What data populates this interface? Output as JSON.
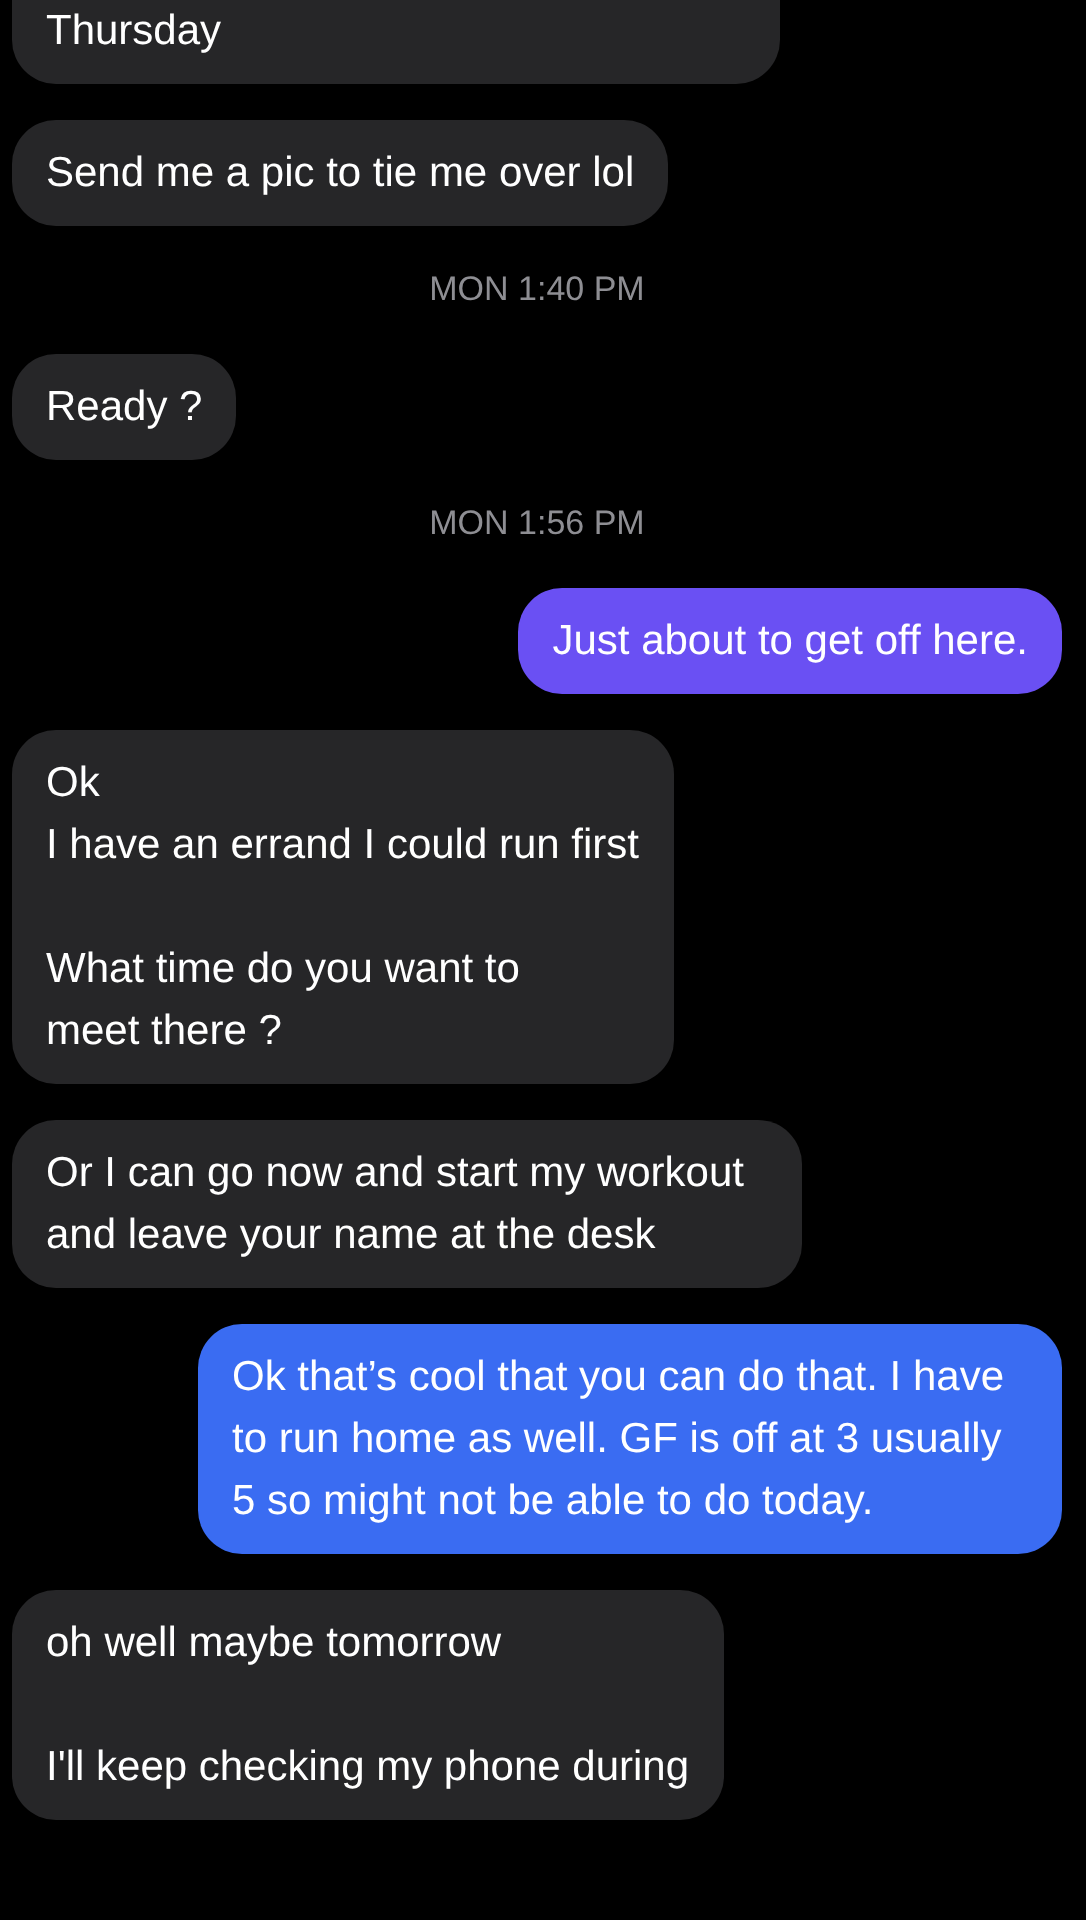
{
  "messages": [
    {
      "kind": "received",
      "text": "Thursday"
    },
    {
      "kind": "received",
      "text": "Send me a pic to tie me over lol"
    },
    {
      "kind": "timestamp",
      "text": "MON 1:40 PM"
    },
    {
      "kind": "received",
      "text": "Ready ?"
    },
    {
      "kind": "timestamp",
      "text": "MON 1:56 PM"
    },
    {
      "kind": "sent",
      "text": "Just about to get off here.",
      "color": "#6a50f3"
    },
    {
      "kind": "received",
      "text": "Ok\nI have an errand I could run first\n\nWhat time do you want to\nmeet there ?"
    },
    {
      "kind": "received",
      "text": "Or I can go now and start my workout and leave your name at the desk"
    },
    {
      "kind": "sent",
      "text": "Ok that’s cool that you can do that. I have to run home as well. GF is off at 3 usually 5 so might not be able to do today.",
      "color": "#3a6cf2"
    },
    {
      "kind": "received",
      "text": "oh well maybe tomorrow\n\nI'll keep checking my phone during"
    }
  ]
}
